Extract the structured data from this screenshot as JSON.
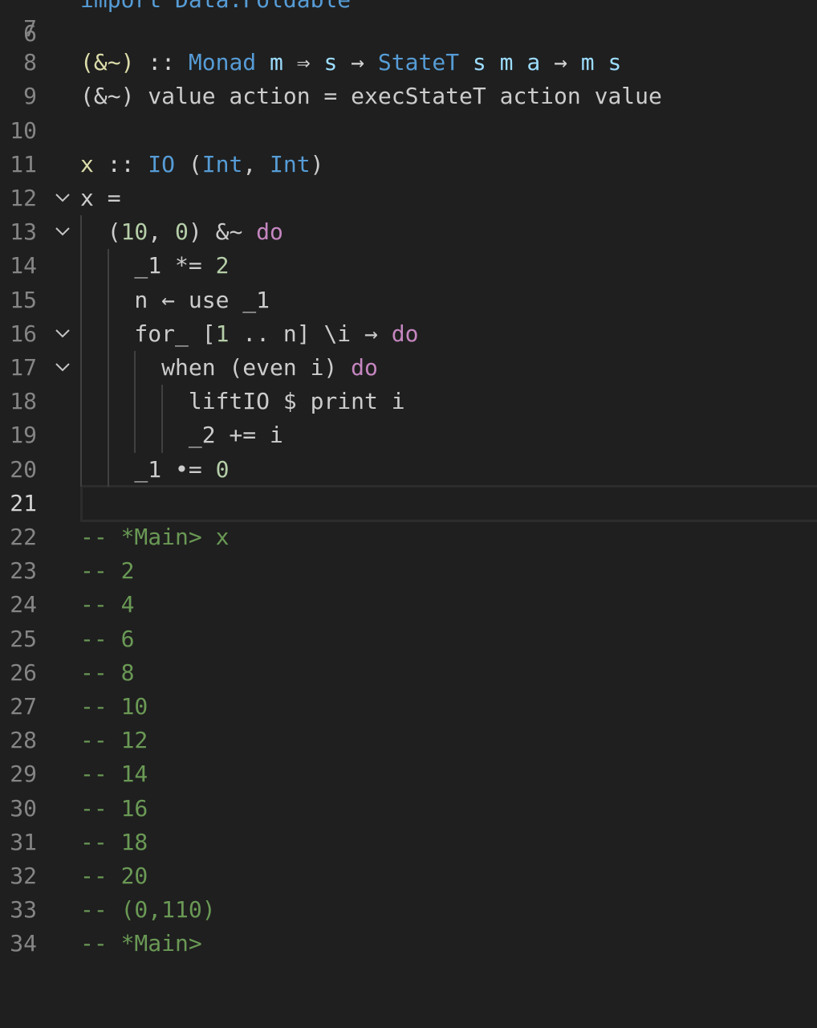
{
  "editor": {
    "partial_top_line": "import Data.Foldable",
    "partial_top_number": "6",
    "lines": [
      {
        "n": "7",
        "tokens": []
      },
      {
        "n": "8",
        "tokens": [
          {
            "t": "(&~)",
            "c": "fn"
          },
          {
            "t": " :: ",
            "c": "op"
          },
          {
            "t": "Monad",
            "c": "type"
          },
          {
            "t": " ",
            "c": "plain"
          },
          {
            "t": "m",
            "c": "var"
          },
          {
            "t": " ⇒ ",
            "c": "op"
          },
          {
            "t": "s",
            "c": "var"
          },
          {
            "t": " → ",
            "c": "op"
          },
          {
            "t": "StateT",
            "c": "type"
          },
          {
            "t": " ",
            "c": "plain"
          },
          {
            "t": "s",
            "c": "var"
          },
          {
            "t": " ",
            "c": "plain"
          },
          {
            "t": "m",
            "c": "var"
          },
          {
            "t": " ",
            "c": "plain"
          },
          {
            "t": "a",
            "c": "var"
          },
          {
            "t": " → ",
            "c": "op"
          },
          {
            "t": "m",
            "c": "var"
          },
          {
            "t": " ",
            "c": "plain"
          },
          {
            "t": "s",
            "c": "var"
          }
        ]
      },
      {
        "n": "9",
        "tokens": [
          {
            "t": "(&~) value action = execStateT action value",
            "c": "plain"
          }
        ]
      },
      {
        "n": "10",
        "tokens": []
      },
      {
        "n": "11",
        "tokens": [
          {
            "t": "x",
            "c": "fn"
          },
          {
            "t": " :: ",
            "c": "op"
          },
          {
            "t": "IO",
            "c": "type"
          },
          {
            "t": " (",
            "c": "plain"
          },
          {
            "t": "Int",
            "c": "type"
          },
          {
            "t": ", ",
            "c": "plain"
          },
          {
            "t": "Int",
            "c": "type"
          },
          {
            "t": ")",
            "c": "plain"
          }
        ],
        "fold": false
      },
      {
        "n": "12",
        "fold": true,
        "tokens": [
          {
            "t": "x =",
            "c": "plain"
          }
        ]
      },
      {
        "n": "13",
        "fold": true,
        "tokens": [
          {
            "t": "  (",
            "c": "plain"
          },
          {
            "t": "10",
            "c": "num"
          },
          {
            "t": ", ",
            "c": "plain"
          },
          {
            "t": "0",
            "c": "num"
          },
          {
            "t": ") &~ ",
            "c": "plain"
          },
          {
            "t": "do",
            "c": "kw"
          }
        ]
      },
      {
        "n": "14",
        "tokens": [
          {
            "t": "    _1 *= ",
            "c": "plain"
          },
          {
            "t": "2",
            "c": "num"
          }
        ]
      },
      {
        "n": "15",
        "tokens": [
          {
            "t": "    n ← use _1",
            "c": "plain"
          }
        ]
      },
      {
        "n": "16",
        "fold": true,
        "tokens": [
          {
            "t": "    for_ [",
            "c": "plain"
          },
          {
            "t": "1",
            "c": "num"
          },
          {
            "t": " .. n] \\i → ",
            "c": "plain"
          },
          {
            "t": "do",
            "c": "kw"
          }
        ]
      },
      {
        "n": "17",
        "fold": true,
        "tokens": [
          {
            "t": "      when (even i) ",
            "c": "plain"
          },
          {
            "t": "do",
            "c": "kw"
          }
        ]
      },
      {
        "n": "18",
        "tokens": [
          {
            "t": "        liftIO $ print i",
            "c": "plain"
          }
        ]
      },
      {
        "n": "19",
        "tokens": [
          {
            "t": "        _2 += i",
            "c": "plain"
          }
        ]
      },
      {
        "n": "20",
        "tokens": [
          {
            "t": "    _1 •= ",
            "c": "plain"
          },
          {
            "t": "0",
            "c": "num"
          }
        ]
      },
      {
        "n": "21",
        "current": true,
        "tokens": []
      },
      {
        "n": "22",
        "tokens": [
          {
            "t": "-- *Main> x",
            "c": "comment"
          }
        ]
      },
      {
        "n": "23",
        "tokens": [
          {
            "t": "-- 2",
            "c": "comment"
          }
        ]
      },
      {
        "n": "24",
        "tokens": [
          {
            "t": "-- 4",
            "c": "comment"
          }
        ]
      },
      {
        "n": "25",
        "tokens": [
          {
            "t": "-- 6",
            "c": "comment"
          }
        ]
      },
      {
        "n": "26",
        "tokens": [
          {
            "t": "-- 8",
            "c": "comment"
          }
        ]
      },
      {
        "n": "27",
        "tokens": [
          {
            "t": "-- 10",
            "c": "comment"
          }
        ]
      },
      {
        "n": "28",
        "tokens": [
          {
            "t": "-- 12",
            "c": "comment"
          }
        ]
      },
      {
        "n": "29",
        "tokens": [
          {
            "t": "-- 14",
            "c": "comment"
          }
        ]
      },
      {
        "n": "30",
        "tokens": [
          {
            "t": "-- 16",
            "c": "comment"
          }
        ]
      },
      {
        "n": "31",
        "tokens": [
          {
            "t": "-- 18",
            "c": "comment"
          }
        ]
      },
      {
        "n": "32",
        "tokens": [
          {
            "t": "-- 20",
            "c": "comment"
          }
        ]
      },
      {
        "n": "33",
        "tokens": [
          {
            "t": "-- (0,110)",
            "c": "comment"
          }
        ]
      },
      {
        "n": "34",
        "tokens": [
          {
            "t": "-- *Main>",
            "c": "comment"
          }
        ]
      }
    ]
  },
  "colors": {
    "background": "#1f1f1f",
    "line_number": "#858585",
    "type": "#569cd6",
    "variable": "#9cdcfe",
    "keyword": "#c586c0",
    "number": "#b5cea8",
    "function": "#dcdcaa",
    "comment": "#6a9955"
  },
  "icons": {
    "fold": "chevron-down-icon"
  }
}
